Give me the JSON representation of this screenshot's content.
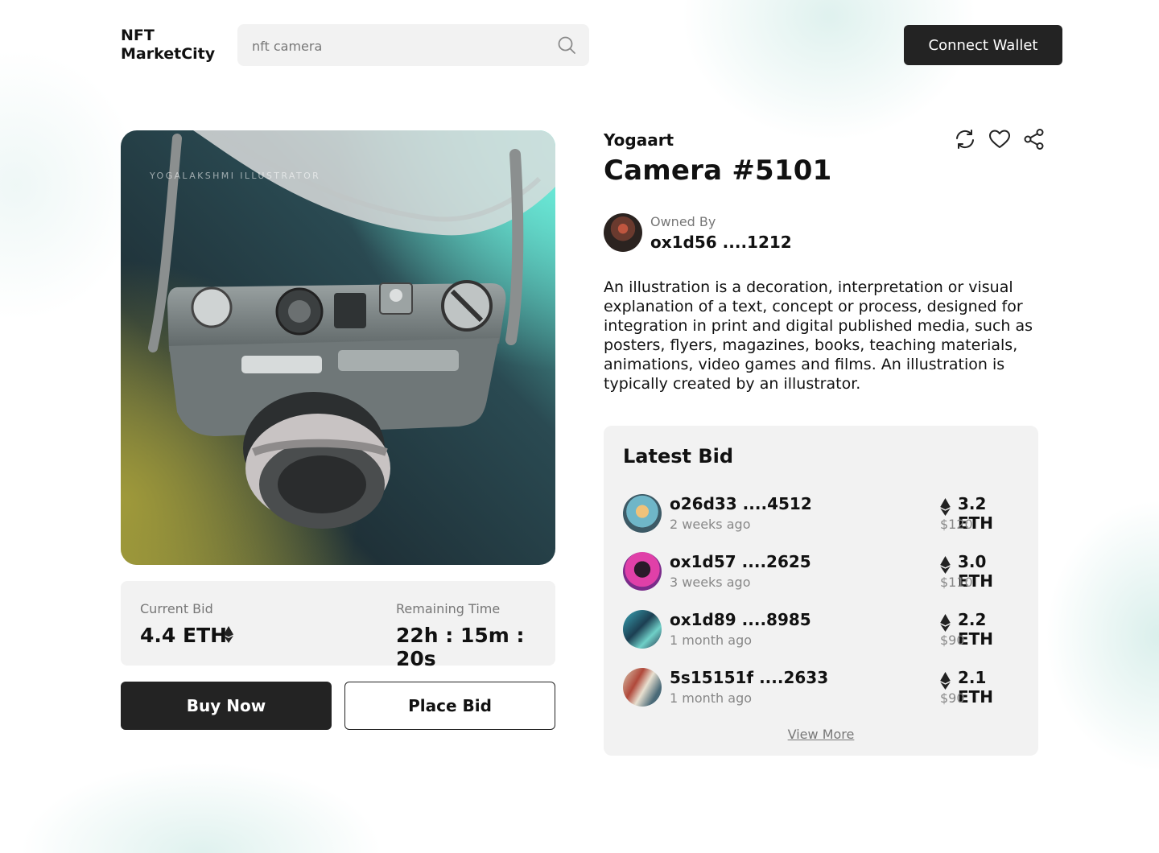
{
  "header": {
    "logo_line1": "NFT",
    "logo_line2": "MarketCity",
    "search_placeholder": "nft camera",
    "search_icon": "search-icon",
    "connect_label": "Connect Wallet"
  },
  "artwork": {
    "caption": "YOGALAKSHMI ILLUSTRATOR",
    "accent": "#5fe0d0"
  },
  "bid": {
    "current_label": "Current Bid",
    "current_value": "4.4 ETH",
    "remaining_label": "Remaining Time",
    "remaining_value": "22h : 15m : 20s"
  },
  "buttons": {
    "buy": "Buy Now",
    "place": "Place Bid"
  },
  "item": {
    "collection": "Yogaart",
    "title": "Camera #5101",
    "action_icons": [
      "refresh-icon",
      "heart-icon",
      "share-icon"
    ],
    "owned_label": "Owned By",
    "owner": "ox1d56 ....1212",
    "description": "An illustration is a decoration, interpretation or visual explanation of a text, concept or process, designed for integration in print and digital published media, such as posters, flyers, magazines, books, teaching materials, animations, video games and films. An illustration is typically created by an illustrator."
  },
  "latest": {
    "heading": "Latest Bid",
    "view_more": "View More",
    "bids": [
      {
        "address": "o26d33 ....4512",
        "time": "2 weeks ago",
        "amount": "3.2 ETH",
        "usd": "$120"
      },
      {
        "address": "ox1d57 ....2625",
        "time": "3 weeks ago",
        "amount": "3.0 ETH",
        "usd": "$110"
      },
      {
        "address": "ox1d89 ....8985",
        "time": "1 month ago",
        "amount": "2.2 ETH",
        "usd": "$90"
      },
      {
        "address": "5s15151f ....2633",
        "time": "1 month ago",
        "amount": "2.1 ETH",
        "usd": "$90"
      }
    ]
  }
}
